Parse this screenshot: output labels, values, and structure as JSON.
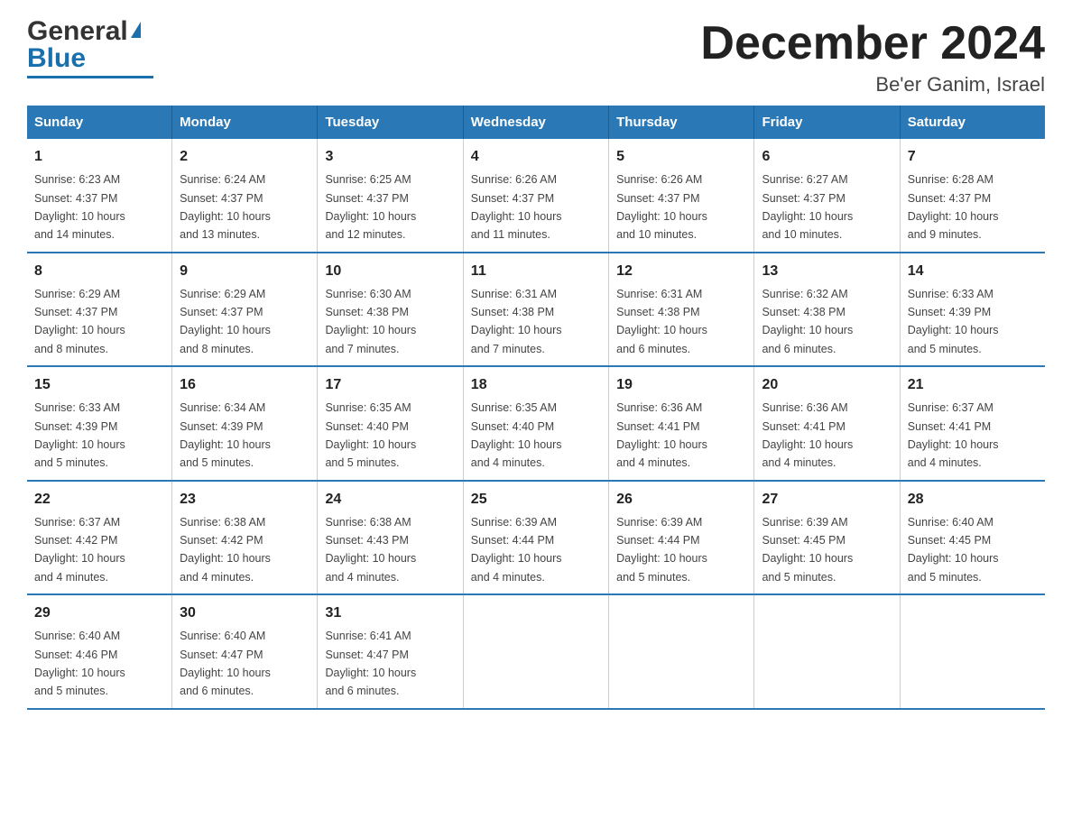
{
  "logo": {
    "general": "General",
    "blue": "Blue",
    "triangle_alt": "arrow"
  },
  "title": "December 2024",
  "subtitle": "Be'er Ganim, Israel",
  "headers": [
    "Sunday",
    "Monday",
    "Tuesday",
    "Wednesday",
    "Thursday",
    "Friday",
    "Saturday"
  ],
  "weeks": [
    [
      {
        "day": "1",
        "sunrise": "6:23 AM",
        "sunset": "4:37 PM",
        "daylight": "10 hours and 14 minutes."
      },
      {
        "day": "2",
        "sunrise": "6:24 AM",
        "sunset": "4:37 PM",
        "daylight": "10 hours and 13 minutes."
      },
      {
        "day": "3",
        "sunrise": "6:25 AM",
        "sunset": "4:37 PM",
        "daylight": "10 hours and 12 minutes."
      },
      {
        "day": "4",
        "sunrise": "6:26 AM",
        "sunset": "4:37 PM",
        "daylight": "10 hours and 11 minutes."
      },
      {
        "day": "5",
        "sunrise": "6:26 AM",
        "sunset": "4:37 PM",
        "daylight": "10 hours and 10 minutes."
      },
      {
        "day": "6",
        "sunrise": "6:27 AM",
        "sunset": "4:37 PM",
        "daylight": "10 hours and 10 minutes."
      },
      {
        "day": "7",
        "sunrise": "6:28 AM",
        "sunset": "4:37 PM",
        "daylight": "10 hours and 9 minutes."
      }
    ],
    [
      {
        "day": "8",
        "sunrise": "6:29 AM",
        "sunset": "4:37 PM",
        "daylight": "10 hours and 8 minutes."
      },
      {
        "day": "9",
        "sunrise": "6:29 AM",
        "sunset": "4:37 PM",
        "daylight": "10 hours and 8 minutes."
      },
      {
        "day": "10",
        "sunrise": "6:30 AM",
        "sunset": "4:38 PM",
        "daylight": "10 hours and 7 minutes."
      },
      {
        "day": "11",
        "sunrise": "6:31 AM",
        "sunset": "4:38 PM",
        "daylight": "10 hours and 7 minutes."
      },
      {
        "day": "12",
        "sunrise": "6:31 AM",
        "sunset": "4:38 PM",
        "daylight": "10 hours and 6 minutes."
      },
      {
        "day": "13",
        "sunrise": "6:32 AM",
        "sunset": "4:38 PM",
        "daylight": "10 hours and 6 minutes."
      },
      {
        "day": "14",
        "sunrise": "6:33 AM",
        "sunset": "4:39 PM",
        "daylight": "10 hours and 5 minutes."
      }
    ],
    [
      {
        "day": "15",
        "sunrise": "6:33 AM",
        "sunset": "4:39 PM",
        "daylight": "10 hours and 5 minutes."
      },
      {
        "day": "16",
        "sunrise": "6:34 AM",
        "sunset": "4:39 PM",
        "daylight": "10 hours and 5 minutes."
      },
      {
        "day": "17",
        "sunrise": "6:35 AM",
        "sunset": "4:40 PM",
        "daylight": "10 hours and 5 minutes."
      },
      {
        "day": "18",
        "sunrise": "6:35 AM",
        "sunset": "4:40 PM",
        "daylight": "10 hours and 4 minutes."
      },
      {
        "day": "19",
        "sunrise": "6:36 AM",
        "sunset": "4:41 PM",
        "daylight": "10 hours and 4 minutes."
      },
      {
        "day": "20",
        "sunrise": "6:36 AM",
        "sunset": "4:41 PM",
        "daylight": "10 hours and 4 minutes."
      },
      {
        "day": "21",
        "sunrise": "6:37 AM",
        "sunset": "4:41 PM",
        "daylight": "10 hours and 4 minutes."
      }
    ],
    [
      {
        "day": "22",
        "sunrise": "6:37 AM",
        "sunset": "4:42 PM",
        "daylight": "10 hours and 4 minutes."
      },
      {
        "day": "23",
        "sunrise": "6:38 AM",
        "sunset": "4:42 PM",
        "daylight": "10 hours and 4 minutes."
      },
      {
        "day": "24",
        "sunrise": "6:38 AM",
        "sunset": "4:43 PM",
        "daylight": "10 hours and 4 minutes."
      },
      {
        "day": "25",
        "sunrise": "6:39 AM",
        "sunset": "4:44 PM",
        "daylight": "10 hours and 4 minutes."
      },
      {
        "day": "26",
        "sunrise": "6:39 AM",
        "sunset": "4:44 PM",
        "daylight": "10 hours and 5 minutes."
      },
      {
        "day": "27",
        "sunrise": "6:39 AM",
        "sunset": "4:45 PM",
        "daylight": "10 hours and 5 minutes."
      },
      {
        "day": "28",
        "sunrise": "6:40 AM",
        "sunset": "4:45 PM",
        "daylight": "10 hours and 5 minutes."
      }
    ],
    [
      {
        "day": "29",
        "sunrise": "6:40 AM",
        "sunset": "4:46 PM",
        "daylight": "10 hours and 5 minutes."
      },
      {
        "day": "30",
        "sunrise": "6:40 AM",
        "sunset": "4:47 PM",
        "daylight": "10 hours and 6 minutes."
      },
      {
        "day": "31",
        "sunrise": "6:41 AM",
        "sunset": "4:47 PM",
        "daylight": "10 hours and 6 minutes."
      },
      null,
      null,
      null,
      null
    ]
  ],
  "sunrise_label": "Sunrise:",
  "sunset_label": "Sunset:",
  "daylight_label": "Daylight:"
}
